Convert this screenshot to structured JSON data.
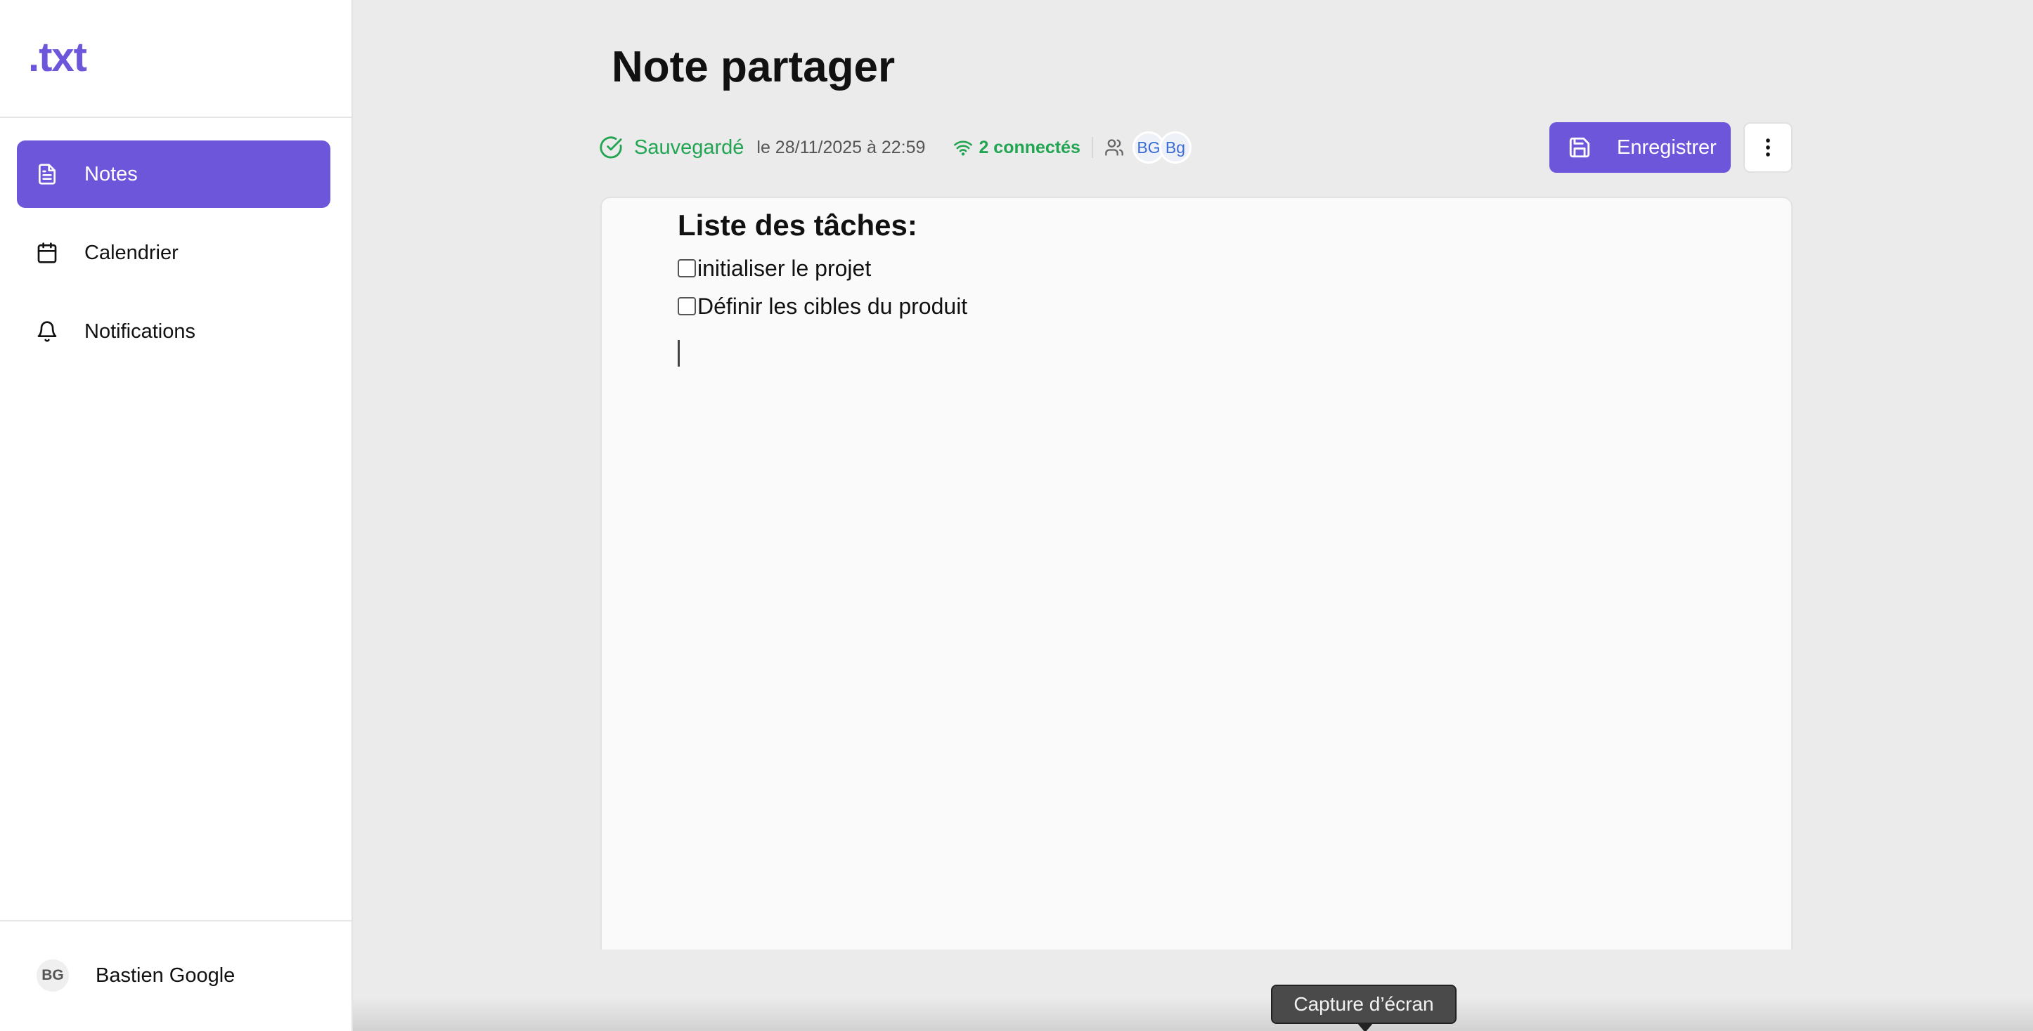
{
  "app": {
    "logo": ".txt"
  },
  "colors": {
    "accent": "#6e56db",
    "success": "#22a552",
    "presence": "#3a6bd6"
  },
  "sidebar": {
    "items": [
      {
        "label": "Notes",
        "icon": "document-icon",
        "active": true
      },
      {
        "label": "Calendrier",
        "icon": "calendar-icon",
        "active": false
      },
      {
        "label": "Notifications",
        "icon": "bell-icon",
        "active": false
      }
    ],
    "user": {
      "initials": "BG",
      "name": "Bastien Google"
    }
  },
  "header": {
    "title": "Note partager",
    "status": {
      "saved_label": "Sauvegardé",
      "saved_date": "le 28/11/2025 à 22:59",
      "connected_label": "2 connectés",
      "participants": [
        "BG",
        "Bg"
      ]
    },
    "save_button_label": "Enregistrer",
    "more_icon": "more-vertical-icon"
  },
  "editor": {
    "heading": "Liste des tâches:",
    "tasks": [
      {
        "text": "initialiser le projet",
        "checked": false
      },
      {
        "text": "Définir les cibles du produit",
        "checked": false
      }
    ]
  },
  "tooltip": {
    "label": "Capture d’écran"
  }
}
